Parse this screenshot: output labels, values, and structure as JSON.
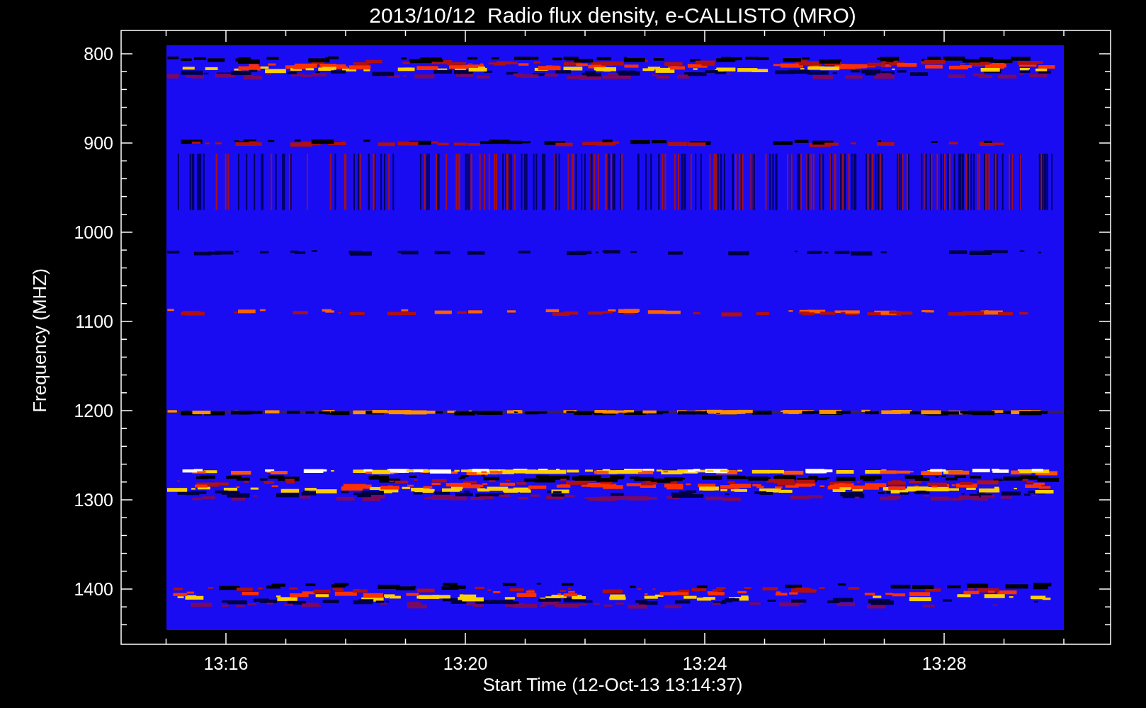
{
  "plot": {
    "title": "2013/10/12  Radio flux density, e-CALLISTO (MRO)",
    "ylabel": "Frequency (MHZ)",
    "xlabel": "Start Time (12-Oct-13 13:14:37)",
    "y_ticks": [
      "800",
      "900",
      "1000",
      "1100",
      "1200",
      "1300",
      "1400"
    ],
    "x_ticks": [
      "13:16",
      "13:20",
      "13:24",
      "13:28"
    ]
  }
}
